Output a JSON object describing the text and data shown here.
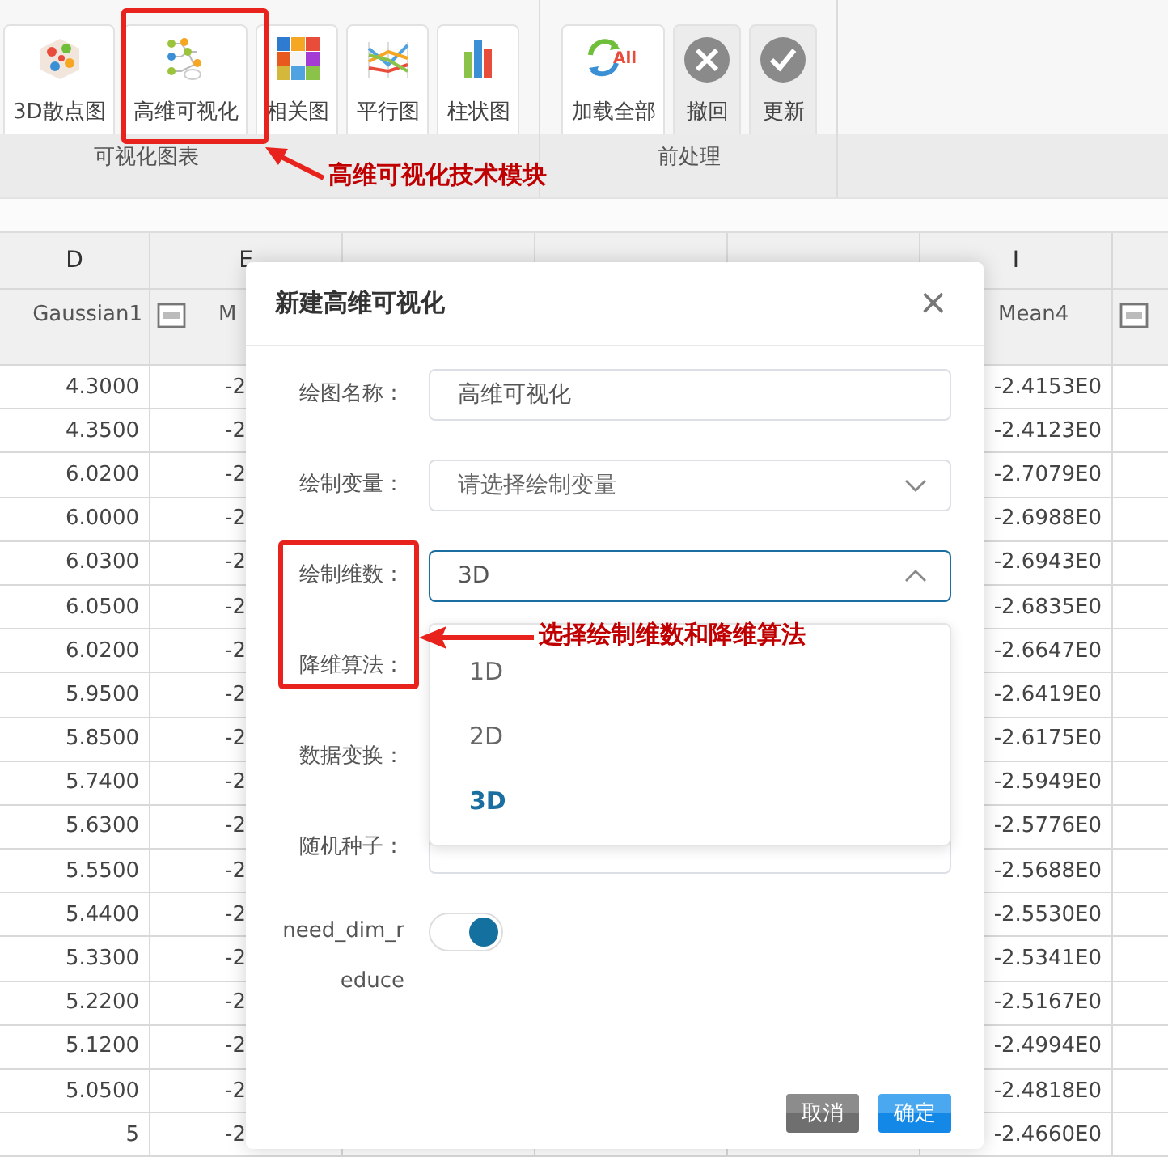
{
  "toolbar": {
    "groups": [
      {
        "label": "可视化图表",
        "buttons": [
          {
            "kind": "scatter3d",
            "label": "3D散点图"
          },
          {
            "kind": "tree",
            "label": "高维可视化"
          },
          {
            "kind": "heatmap",
            "label": "相关图"
          },
          {
            "kind": "parallel",
            "label": "平行图"
          },
          {
            "kind": "bars",
            "label": "柱状图"
          }
        ]
      },
      {
        "label": "前处理",
        "buttons": [
          {
            "kind": "reload",
            "label": "加载全部",
            "icon_text": "All"
          },
          {
            "kind": "undo",
            "label": "撤回"
          },
          {
            "kind": "update",
            "label": "更新"
          }
        ]
      }
    ]
  },
  "sheet": {
    "columns": [
      {
        "letter": "D",
        "name": "Gaussian1"
      },
      {
        "letter": "E",
        "name": "M",
        "numeric_icon": true
      },
      {},
      {},
      {},
      {
        "letter": "I",
        "name": "Mean4"
      },
      {
        "numeric_icon": true
      }
    ],
    "rows": [
      [
        "4.3000",
        "-2",
        "-2.4153E0"
      ],
      [
        "4.3500",
        "-2",
        "-2.4123E0"
      ],
      [
        "6.0200",
        "-2",
        "-2.7079E0"
      ],
      [
        "6.0000",
        "-2",
        "-2.6988E0"
      ],
      [
        "6.0300",
        "-2",
        "-2.6943E0"
      ],
      [
        "6.0500",
        "-2",
        "-2.6835E0"
      ],
      [
        "6.0200",
        "-2",
        "-2.6647E0"
      ],
      [
        "5.9500",
        "-2",
        "-2.6419E0"
      ],
      [
        "5.8500",
        "-2",
        "-2.6175E0"
      ],
      [
        "5.7400",
        "-2",
        "-2.5949E0"
      ],
      [
        "5.6300",
        "-2",
        "-2.5776E0"
      ],
      [
        "5.5500",
        "-2",
        "-2.5688E0"
      ],
      [
        "5.4400",
        "-2",
        "-2.5530E0"
      ],
      [
        "5.3300",
        "-2",
        "-2.5341E0"
      ],
      [
        "5.2200",
        "-2",
        "-2.5167E0"
      ],
      [
        "5.1200",
        "-2",
        "-2.4994E0"
      ],
      [
        "5.0500",
        "-2",
        "-2.4818E0"
      ],
      [
        "5",
        "-2",
        "-2.4660E0"
      ]
    ]
  },
  "dialog": {
    "title": "新建高维可视化",
    "close": "×",
    "fields": [
      {
        "kind": "text",
        "label": "绘图名称：",
        "value": "高维可视化"
      },
      {
        "kind": "select",
        "label": "绘制变量：",
        "placeholder": "请选择绘制变量",
        "expanded": false
      },
      {
        "kind": "select",
        "label": "绘制维数：",
        "value": "3D",
        "expanded": true,
        "options": [
          {
            "label": "1D",
            "selected": false
          },
          {
            "label": "2D",
            "selected": false
          },
          {
            "label": "3D",
            "selected": true
          }
        ]
      },
      {
        "kind": "hidden",
        "label": "降维算法："
      },
      {
        "kind": "hidden",
        "label": "数据变换："
      },
      {
        "kind": "text",
        "label": "随机种子："
      },
      {
        "kind": "toggle",
        "label": "need_dim_reduce",
        "on": true
      }
    ],
    "buttons": [
      {
        "kind": "cancel",
        "label": "取消"
      },
      {
        "kind": "ok",
        "label": "确定"
      }
    ]
  },
  "annotations": [
    {
      "text": "高维可视化技术模块"
    },
    {
      "text": "选择绘制维数和降维算法"
    }
  ]
}
